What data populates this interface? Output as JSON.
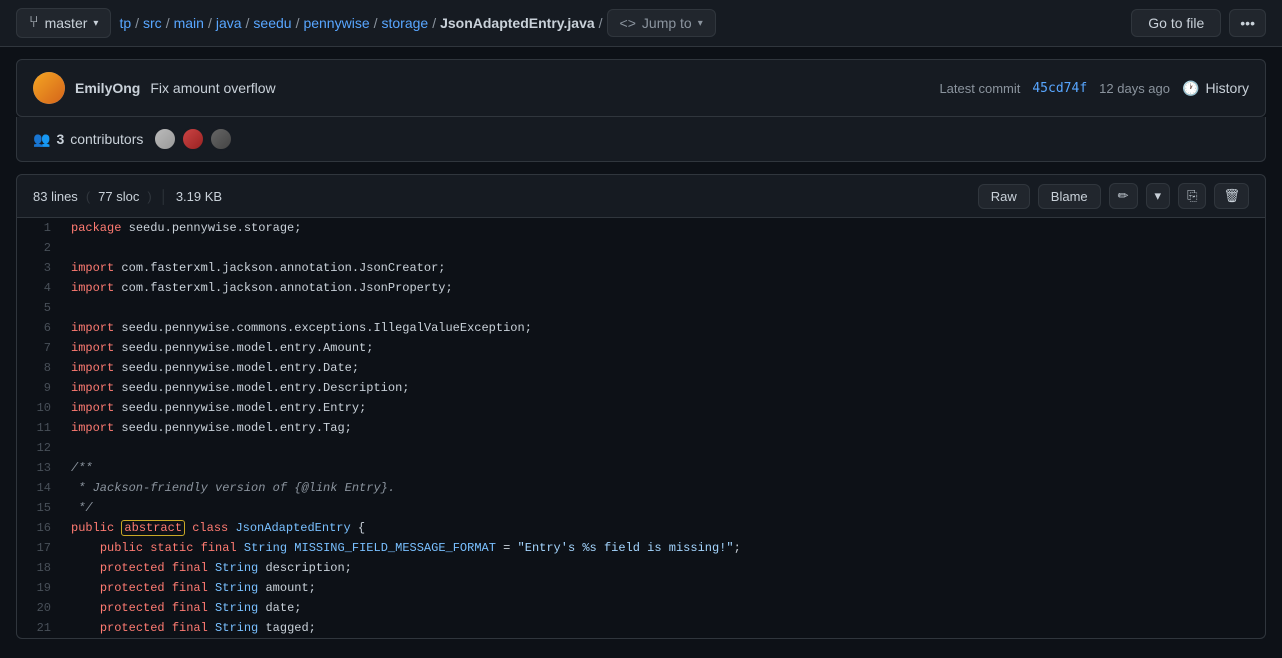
{
  "topbar": {
    "branch": "master",
    "breadcrumb": [
      "tp",
      "src",
      "main",
      "java",
      "seedu",
      "pennywise",
      "storage",
      "JsonAdaptedEntry.java"
    ],
    "jump_to": "Jump to",
    "go_to_file": "Go to file"
  },
  "commit": {
    "author": "EmilyOng",
    "message": "Fix amount overflow",
    "latest_label": "Latest commit",
    "hash": "45cd74f",
    "time": "12 days ago",
    "history_label": "History"
  },
  "contributors": {
    "count": "3",
    "label": "contributors"
  },
  "file_stats": {
    "lines": "83 lines",
    "sloc": "77 sloc",
    "size": "3.19 KB",
    "raw_label": "Raw",
    "blame_label": "Blame"
  },
  "code": {
    "lines": [
      {
        "num": 1,
        "text": "package seedu.pennywise.storage;"
      },
      {
        "num": 2,
        "text": ""
      },
      {
        "num": 3,
        "text": "import com.fasterxml.jackson.annotation.JsonCreator;"
      },
      {
        "num": 4,
        "text": "import com.fasterxml.jackson.annotation.JsonProperty;"
      },
      {
        "num": 5,
        "text": ""
      },
      {
        "num": 6,
        "text": "import seedu.pennywise.commons.exceptions.IllegalValueException;"
      },
      {
        "num": 7,
        "text": "import seedu.pennywise.model.entry.Amount;"
      },
      {
        "num": 8,
        "text": "import seedu.pennywise.model.entry.Date;"
      },
      {
        "num": 9,
        "text": "import seedu.pennywise.model.entry.Description;"
      },
      {
        "num": 10,
        "text": "import seedu.pennywise.model.entry.Entry;"
      },
      {
        "num": 11,
        "text": "import seedu.pennywise.model.entry.Tag;"
      },
      {
        "num": 12,
        "text": ""
      },
      {
        "num": 13,
        "text": "/**"
      },
      {
        "num": 14,
        "text": " * Jackson-friendly version of {@link Entry}."
      },
      {
        "num": 15,
        "text": " */"
      },
      {
        "num": 16,
        "text": "public abstract class JsonAdaptedEntry {"
      },
      {
        "num": 17,
        "text": "    public static final String MISSING_FIELD_MESSAGE_FORMAT = \"Entry's %s field is missing!\";"
      },
      {
        "num": 18,
        "text": "    protected final String description;"
      },
      {
        "num": 19,
        "text": "    protected final String amount;"
      },
      {
        "num": 20,
        "text": "    protected final String date;"
      },
      {
        "num": 21,
        "text": "    protected final String tagged;"
      }
    ]
  }
}
